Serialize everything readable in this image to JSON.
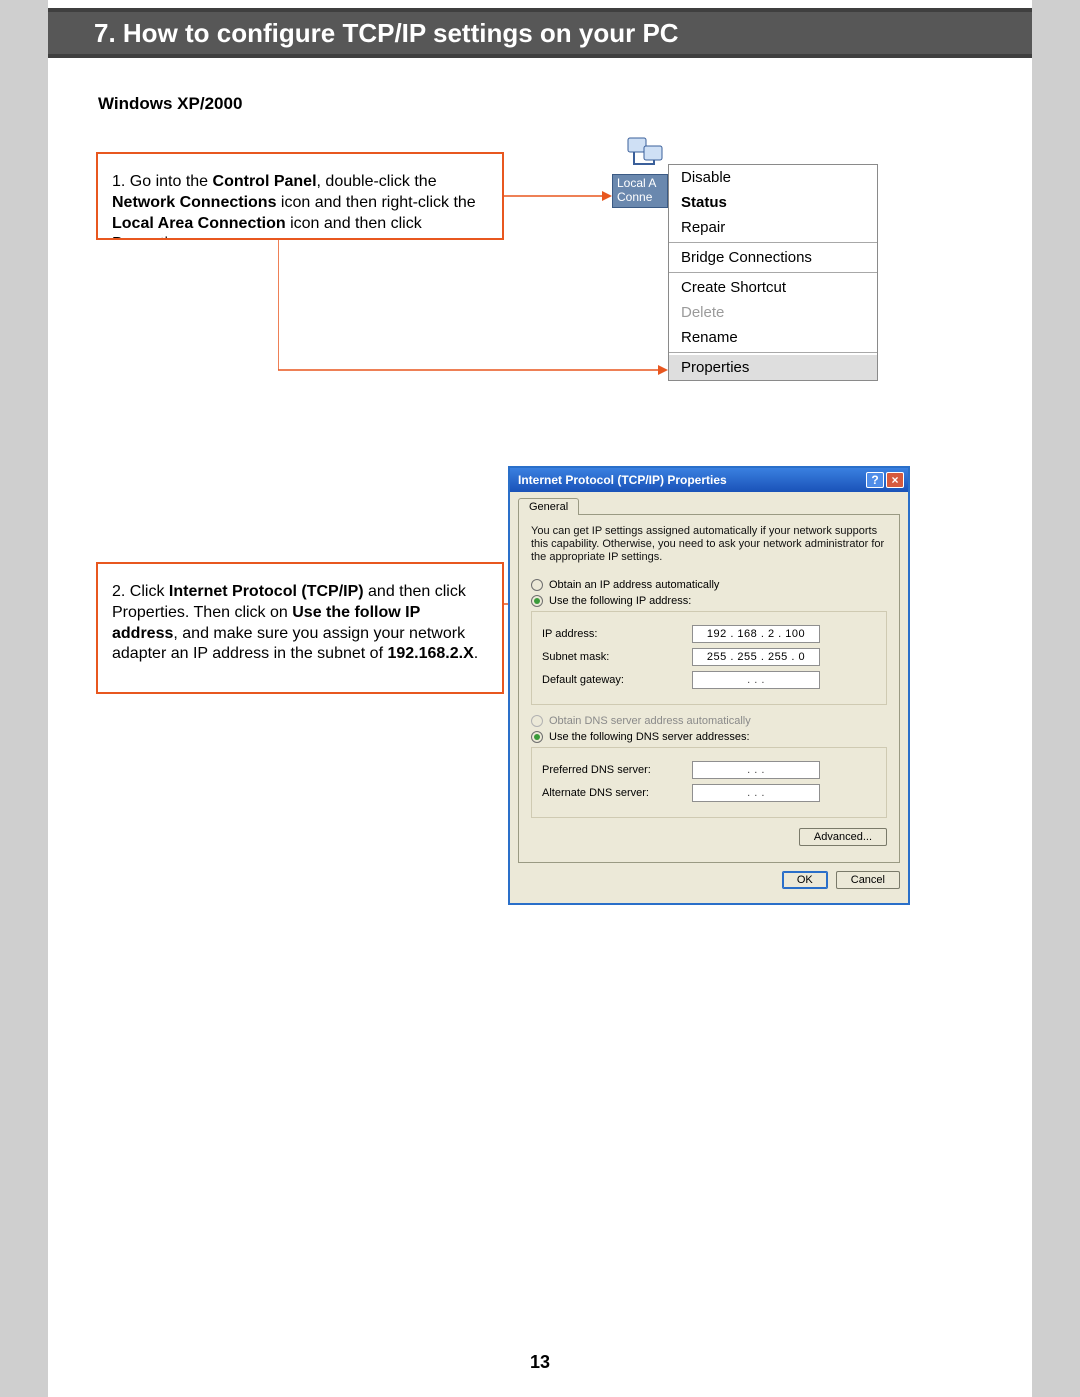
{
  "header": {
    "title": "7. How to configure TCP/IP settings on your PC"
  },
  "subheading": "Windows XP/2000",
  "step1": {
    "prefix": "1. Go into the ",
    "bold1": "Control Panel",
    "mid1": ", double-click the ",
    "bold2": "Network Connections",
    "mid2": " icon and then right-click the ",
    "bold3": "Local Area Connection",
    "suffix": " icon and then click Properties."
  },
  "step2": {
    "prefix": "2. Click ",
    "bold1": "Internet Protocol (TCP/IP)",
    "mid1": " and then click Properties. Then click on ",
    "bold2": "Use the follow IP address",
    "mid2": ", and make sure you assign your network adapter an IP address in the subnet of ",
    "bold3": "192.168.2.X",
    "suffix": "."
  },
  "local_area": {
    "line1": "Local A",
    "line2": "Conne"
  },
  "ctx": {
    "disable": "Disable",
    "status": "Status",
    "repair": "Repair",
    "bridge": "Bridge Connections",
    "shortcut": "Create Shortcut",
    "delete": "Delete",
    "rename": "Rename",
    "properties": "Properties"
  },
  "dialog": {
    "title": "Internet Protocol (TCP/IP) Properties",
    "tab": "General",
    "help": "You can get IP settings assigned automatically if your network supports this capability. Otherwise, you need to ask your network administrator for the appropriate IP settings.",
    "r_auto_ip": "Obtain an IP address automatically",
    "r_manual_ip": "Use the following IP address:",
    "lbl_ip": "IP address:",
    "lbl_mask": "Subnet mask:",
    "lbl_gw": "Default gateway:",
    "val_ip": "192 . 168 .   2  . 100",
    "val_mask": "255 . 255 . 255 .   0",
    "val_gw": ".       .       .",
    "r_auto_dns": "Obtain DNS server address automatically",
    "r_manual_dns": "Use the following DNS server addresses:",
    "lbl_pdns": "Preferred DNS server:",
    "lbl_adns": "Alternate DNS server:",
    "val_pdns": ".       .       .",
    "val_adns": ".       .       .",
    "btn_adv": "Advanced...",
    "btn_ok": "OK",
    "btn_cancel": "Cancel"
  },
  "page_number": "13"
}
